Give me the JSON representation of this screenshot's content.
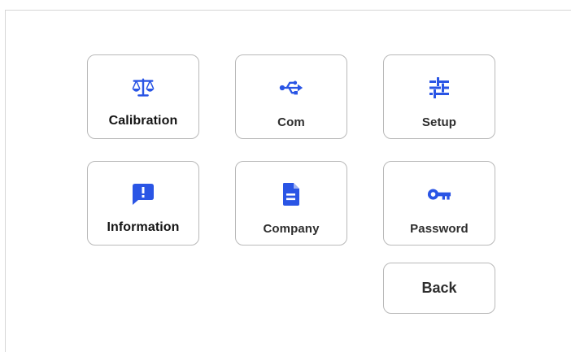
{
  "accent_color": "#2a55e5",
  "menu": {
    "tiles": [
      {
        "label": "Calibration",
        "icon": "scale-icon"
      },
      {
        "label": "Com",
        "icon": "usb-icon"
      },
      {
        "label": "Setup",
        "icon": "sliders-icon"
      },
      {
        "label": "Information",
        "icon": "info-message-icon"
      },
      {
        "label": "Company",
        "icon": "document-icon"
      },
      {
        "label": "Password",
        "icon": "key-icon"
      }
    ],
    "back_label": "Back"
  }
}
